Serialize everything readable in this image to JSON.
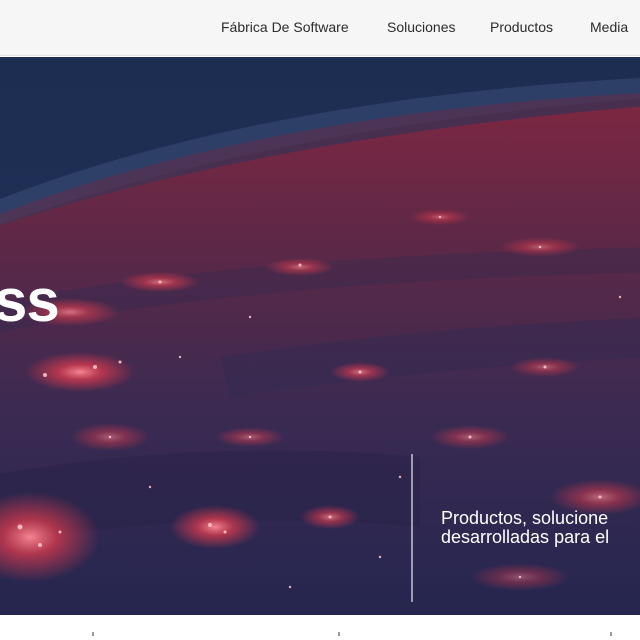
{
  "nav": {
    "items": [
      {
        "label": "Fábrica De Software"
      },
      {
        "label": "Soluciones"
      },
      {
        "label": "Productos"
      },
      {
        "label": "Media"
      }
    ]
  },
  "hero": {
    "headline": "ss",
    "tagline_line1": "Productos, solucione",
    "tagline_line2": "desarrolladas para el",
    "image": "earth-at-night-from-space"
  },
  "colors": {
    "nav_bg": "#f6f6f6",
    "hero_tint": "#1f2a52",
    "city_lights": "#e8414f",
    "text_light": "#ffffff"
  }
}
